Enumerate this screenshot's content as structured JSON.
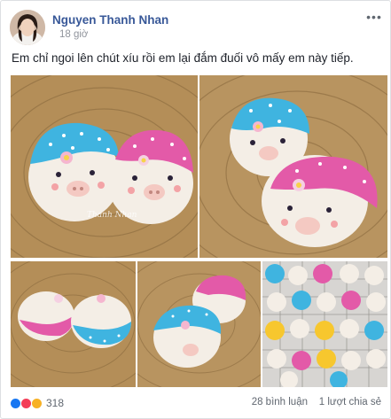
{
  "post": {
    "author": "Nguyen Thanh Nhan",
    "time": "18 giờ",
    "text": "Em chỉ ngoi lên chút xíu rồi em lại đắm đuối vô mấy em này tiếp.",
    "photo_watermark": "Thanh Nhan"
  },
  "footer": {
    "reaction_count": "318",
    "comments": "28 bình luận",
    "shares": "1 lượt chia sẻ"
  },
  "icons": {
    "more": "more-options-icon",
    "like": "like-reaction-icon",
    "love": "love-reaction-icon",
    "wow": "wow-reaction-icon",
    "privacy": "globe-icon"
  },
  "colors": {
    "author_link": "#385898",
    "meta_text": "#90949c",
    "basket": "#c9a56e",
    "bun_blue": "#3fb4e0",
    "bun_pink": "#e35aa8"
  }
}
